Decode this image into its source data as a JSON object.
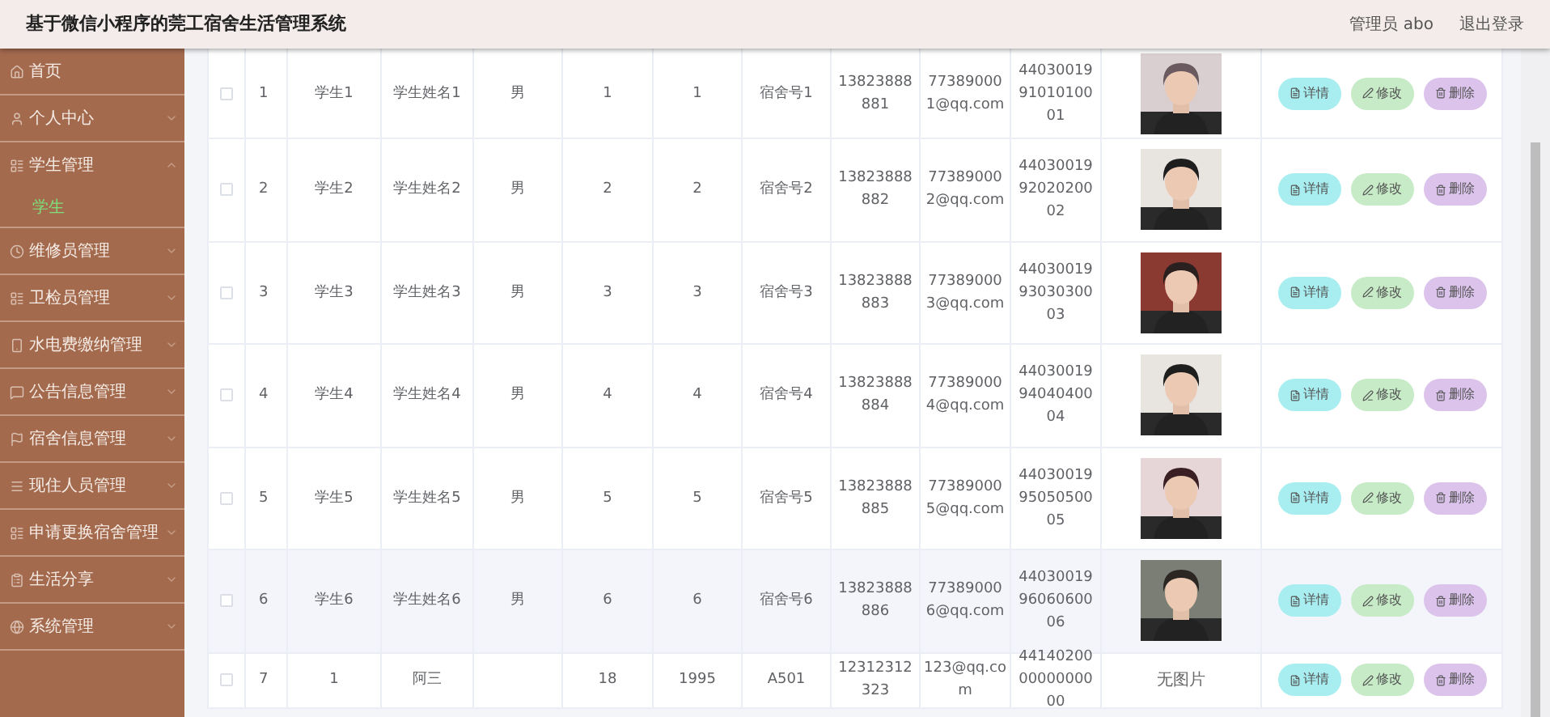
{
  "header": {
    "title": "基于微信小程序的莞工宿舍生活管理系统",
    "user": "管理员 abo",
    "logout": "退出登录"
  },
  "sidebar": {
    "items": [
      {
        "label": "首页",
        "kind": "link"
      },
      {
        "label": "个人中心",
        "kind": "submenu",
        "expanded": false
      },
      {
        "label": "学生管理",
        "kind": "submenu",
        "expanded": true,
        "children": [
          {
            "label": "学生",
            "selected": true
          }
        ]
      },
      {
        "label": "维修员管理",
        "kind": "submenu",
        "expanded": false
      },
      {
        "label": "卫检员管理",
        "kind": "submenu",
        "expanded": false
      },
      {
        "label": "水电费缴纳管理",
        "kind": "submenu",
        "expanded": false
      },
      {
        "label": "公告信息管理",
        "kind": "submenu",
        "expanded": false
      },
      {
        "label": "宿舍信息管理",
        "kind": "submenu",
        "expanded": false
      },
      {
        "label": "现住人员管理",
        "kind": "submenu",
        "expanded": false
      },
      {
        "label": "申请更换宿舍管理",
        "kind": "submenu",
        "expanded": false
      },
      {
        "label": "生活分享",
        "kind": "submenu",
        "expanded": false
      },
      {
        "label": "系统管理",
        "kind": "submenu",
        "expanded": false
      }
    ]
  },
  "table": {
    "rows": [
      {
        "checked": false,
        "highlighted": false,
        "cells": [
          "1",
          "学生1",
          "学生姓名1",
          "男",
          "1",
          "1",
          "宿舍号1",
          "13823888881",
          "773890001@qq.com",
          "440300199101010001"
        ],
        "actions": [
          "详情",
          "修改",
          "删除"
        ]
      },
      {
        "checked": false,
        "highlighted": false,
        "cells": [
          "2",
          "学生2",
          "学生姓名2",
          "男",
          "2",
          "2",
          "宿舍号2",
          "13823888882",
          "773890002@qq.com",
          "440300199202020002"
        ],
        "actions": [
          "详情",
          "修改",
          "删除"
        ]
      },
      {
        "checked": false,
        "highlighted": false,
        "cells": [
          "3",
          "学生3",
          "学生姓名3",
          "男",
          "3",
          "3",
          "宿舍号3",
          "13823888883",
          "773890003@qq.com",
          "440300199303030003"
        ],
        "actions": [
          "详情",
          "修改",
          "删除"
        ]
      },
      {
        "checked": false,
        "highlighted": false,
        "cells": [
          "4",
          "学生4",
          "学生姓名4",
          "男",
          "4",
          "4",
          "宿舍号4",
          "13823888884",
          "773890004@qq.com",
          "440300199404040004"
        ],
        "actions": [
          "详情",
          "修改",
          "删除"
        ]
      },
      {
        "checked": false,
        "highlighted": false,
        "cells": [
          "5",
          "学生5",
          "学生姓名5",
          "男",
          "5",
          "5",
          "宿舍号5",
          "13823888885",
          "773890005@qq.com",
          "440300199505050005"
        ],
        "actions": [
          "详情",
          "修改",
          "删除"
        ]
      },
      {
        "checked": false,
        "highlighted": true,
        "cells": [
          "6",
          "学生6",
          "学生姓名6",
          "男",
          "6",
          "6",
          "宿舍号6",
          "13823888886",
          "773890006@qq.com",
          "440300199606060006"
        ],
        "actions": [
          "详情",
          "修改",
          "删除"
        ]
      },
      {
        "checked": false,
        "highlighted": false,
        "cells": [
          "7",
          "1",
          "阿三",
          "",
          "18",
          "1995",
          "A501",
          "12312312323",
          "123@qq.com",
          "441402000000000000"
        ],
        "photo": {
          "kind": "text",
          "text": "无图片"
        },
        "actions": [
          "详情",
          "修改",
          "删除"
        ]
      }
    ]
  }
}
